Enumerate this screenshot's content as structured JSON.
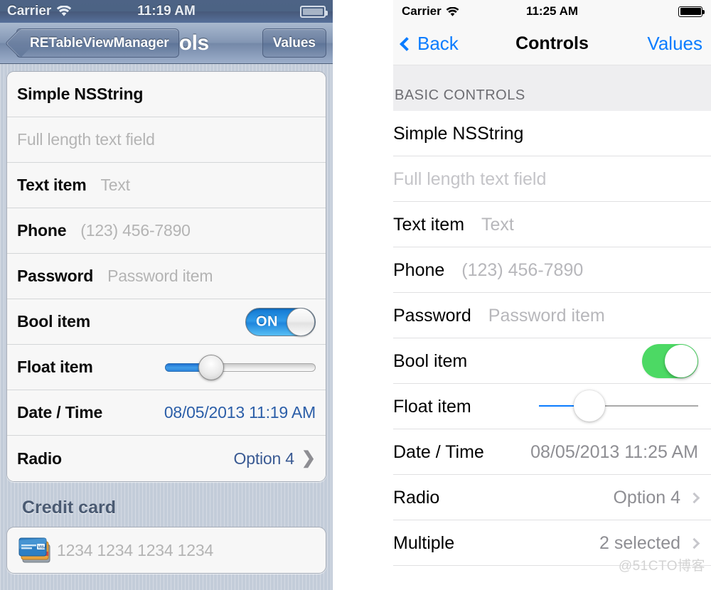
{
  "left_phone": {
    "status_bar": {
      "carrier": "Carrier",
      "wifi_icon": "wifi-icon",
      "time": "11:19 AM",
      "battery_icon": "battery-icon"
    },
    "nav_bar": {
      "back_label": "RETableViewManager",
      "title": "Controls",
      "right_label": "Values"
    },
    "rows": [
      {
        "name": "simple-nsstring",
        "label": "Simple NSString",
        "value": "",
        "kind": "label"
      },
      {
        "name": "full-length-text-field",
        "label": "",
        "placeholder": "Full length text field",
        "kind": "textfield"
      },
      {
        "name": "text-item",
        "label": "Text item",
        "placeholder": "Text",
        "kind": "labeled-textfield"
      },
      {
        "name": "phone",
        "label": "Phone",
        "placeholder": "(123) 456-7890",
        "kind": "labeled-textfield"
      },
      {
        "name": "password",
        "label": "Password",
        "placeholder": "Password item",
        "kind": "labeled-textfield"
      },
      {
        "name": "bool-item",
        "label": "Bool item",
        "switch_label": "ON",
        "switch_on": true,
        "kind": "switch"
      },
      {
        "name": "float-item",
        "label": "Float item",
        "slider_percent": 30,
        "kind": "slider"
      },
      {
        "name": "date-time",
        "label": "Date / Time",
        "value": "08/05/2013 11:19 AM",
        "kind": "value"
      },
      {
        "name": "radio",
        "label": "Radio",
        "value": "Option 4",
        "kind": "disclosure"
      }
    ],
    "section2": {
      "header": "Credit card",
      "card_icon": "credit-card-icon",
      "placeholder": "1234 1234 1234 1234"
    }
  },
  "right_phone": {
    "status_bar": {
      "carrier": "Carrier",
      "wifi_icon": "wifi-icon",
      "time": "11:25 AM",
      "battery_icon": "battery-icon"
    },
    "nav_bar": {
      "back_label": "Back",
      "title": "Controls",
      "right_label": "Values"
    },
    "section_header": "BASIC CONTROLS",
    "rows": [
      {
        "name": "simple-nsstring",
        "label": "Simple NSString",
        "kind": "label"
      },
      {
        "name": "full-length-text-field",
        "placeholder": "Full length text field",
        "kind": "textfield"
      },
      {
        "name": "text-item",
        "label": "Text item",
        "placeholder": "Text",
        "kind": "labeled-textfield"
      },
      {
        "name": "phone",
        "label": "Phone",
        "placeholder": "(123) 456-7890",
        "kind": "labeled-textfield"
      },
      {
        "name": "password",
        "label": "Password",
        "placeholder": "Password item",
        "kind": "labeled-textfield"
      },
      {
        "name": "bool-item",
        "label": "Bool item",
        "switch_on": true,
        "kind": "switch"
      },
      {
        "name": "float-item",
        "label": "Float item",
        "slider_percent": 30,
        "kind": "slider"
      },
      {
        "name": "date-time",
        "label": "Date / Time",
        "value": "08/05/2013 11:25 AM",
        "kind": "value"
      },
      {
        "name": "radio",
        "label": "Radio",
        "value": "Option 4",
        "kind": "disclosure"
      },
      {
        "name": "multiple",
        "label": "Multiple",
        "value": "2 selected",
        "kind": "disclosure"
      }
    ]
  },
  "watermark": "@51CTO博客",
  "colors": {
    "ios6_tint": "#3a5a93",
    "ios6_switch_on": "#2f9ae8",
    "ios7_tint": "#0a7cff",
    "ios7_switch_on": "#4cd964",
    "ios7_section_bg": "#eeeef0"
  }
}
